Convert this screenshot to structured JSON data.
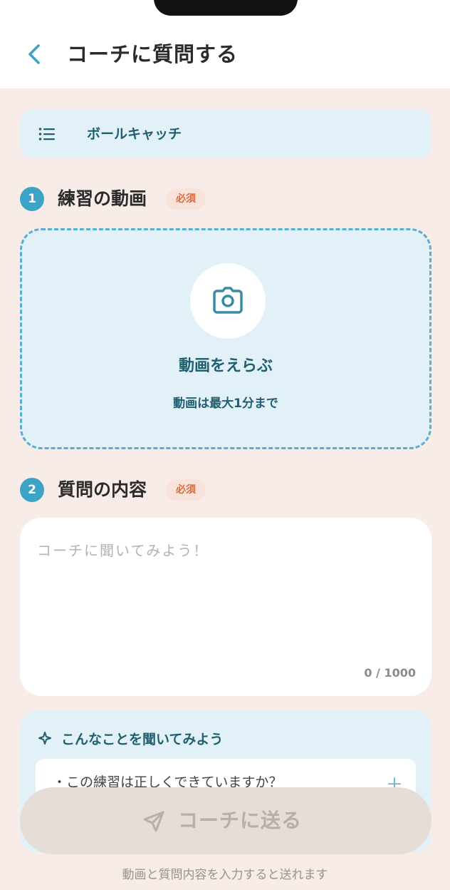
{
  "header": {
    "title": "コーチに質問する"
  },
  "menu": {
    "label": "ボールキャッチ"
  },
  "section1": {
    "number": "1",
    "title": "練習の動画",
    "badge": "必須"
  },
  "upload": {
    "title": "動画をえらぶ",
    "subtitle": "動画は最大1分まで"
  },
  "section2": {
    "number": "2",
    "title": "質問の内容",
    "badge": "必須"
  },
  "question": {
    "placeholder": "コーチに聞いてみよう！",
    "counter": "0 / 1000"
  },
  "hints": {
    "title": "こんなことを聞いてみよう",
    "items": [
      {
        "text": "・この練習は正しくできていますか？"
      }
    ]
  },
  "send": {
    "label": "コーチに送る"
  },
  "footer": {
    "note": "動画と質問内容を入力すると送れます"
  },
  "colors": {
    "accent": "#3ba4c6",
    "accent_dark": "#1f5f6f",
    "required": "#d86a3e",
    "background": "#f7ece8",
    "card": "#e2f1f7"
  },
  "icons": {
    "back": "chevron-left-icon",
    "menu": "list-icon",
    "upload": "camera-icon",
    "hint": "sparkle-icon",
    "hint_add": "plus-icon",
    "send": "paper-plane-icon"
  }
}
